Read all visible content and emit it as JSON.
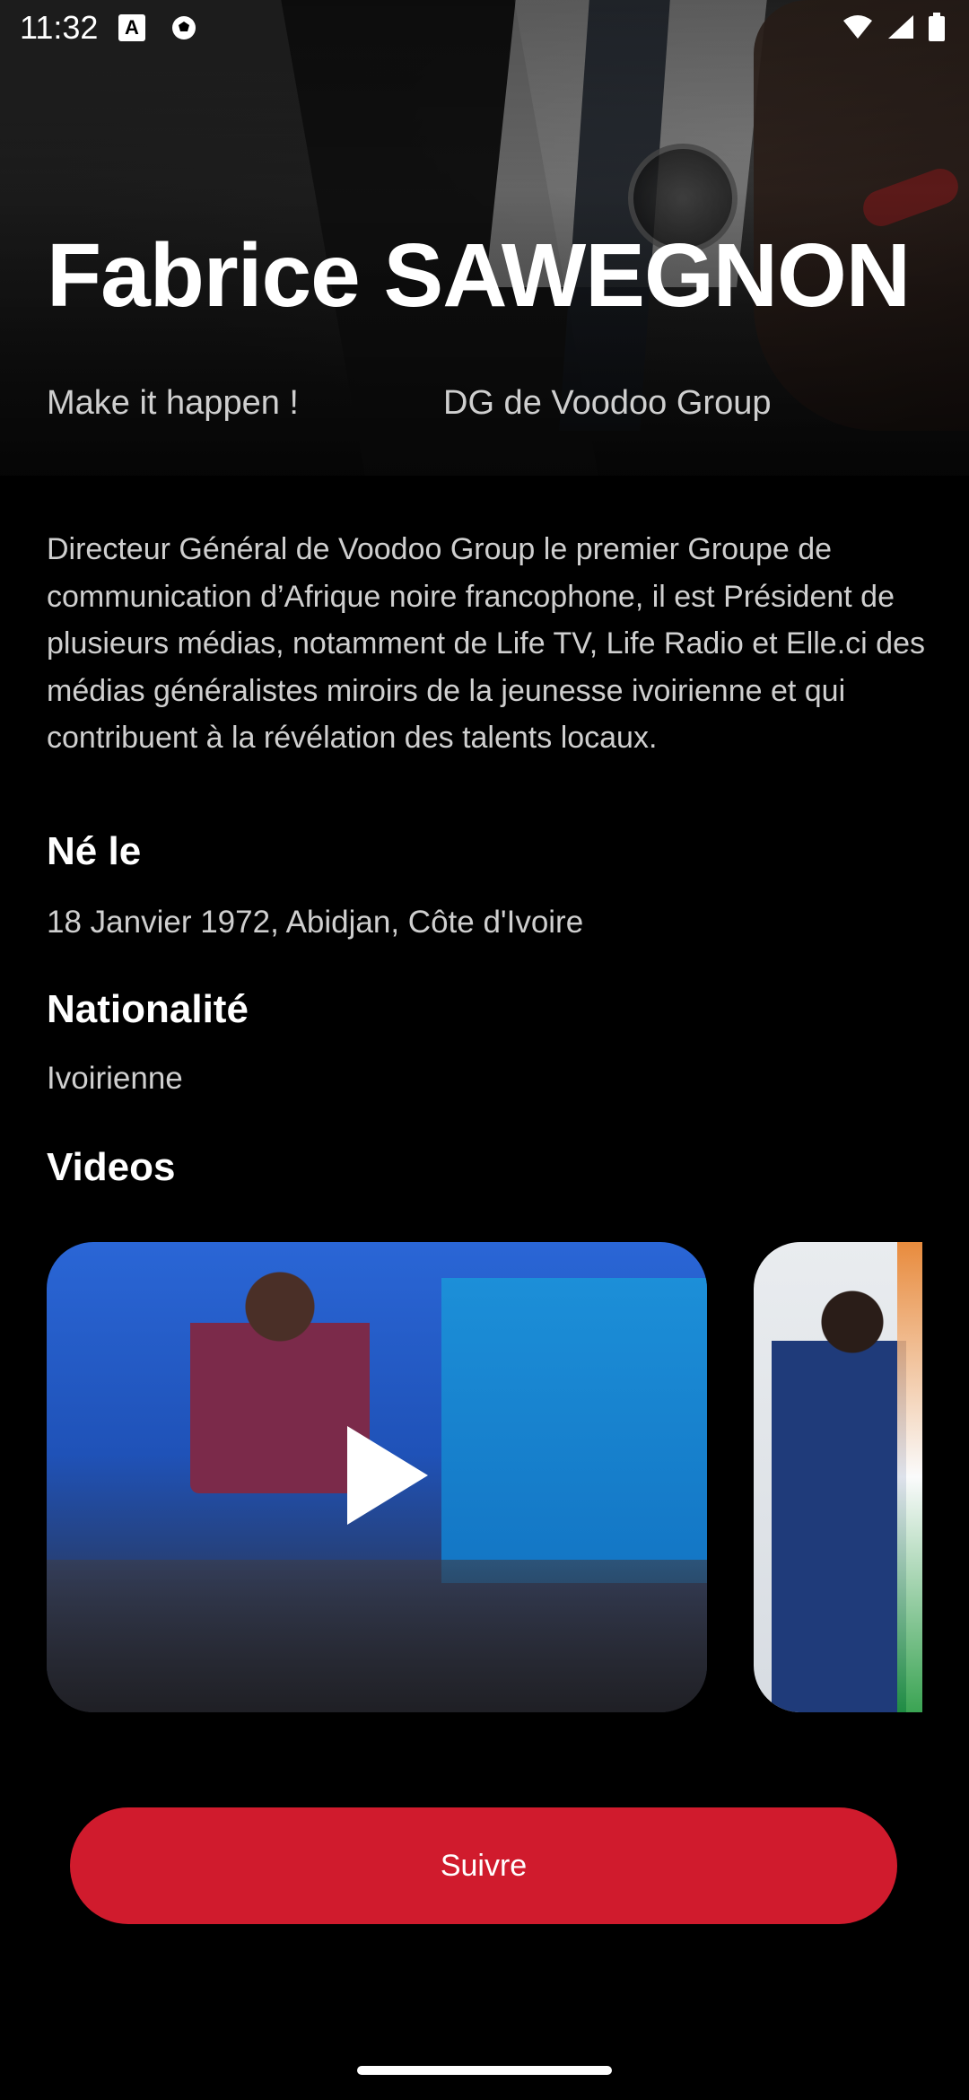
{
  "status_bar": {
    "time": "11:32",
    "left_icons": [
      "a-notification-icon",
      "soccer-ball-icon"
    ],
    "right_icons": [
      "wifi-icon",
      "signal-icon",
      "battery-icon"
    ]
  },
  "profile": {
    "name": "Fabrice SAWEGNON",
    "tagline": "Make it happen !",
    "role": "DG de Voodoo Group",
    "bio": "Directeur Général de Voodoo Group le premier Groupe de communication d’Afrique noire francophone, il est Président de plusieurs médias, notamment de  Life TV, Life Radio et Elle.ci des médias généralistes miroirs de la jeunesse ivoirienne et qui contribuent à la révélation des talents locaux."
  },
  "birth": {
    "title": "Né le",
    "value": "18 Janvier 1972, Abidjan, Côte d'Ivoire"
  },
  "nationality": {
    "title": "Nationalité",
    "value": "Ivoirienne"
  },
  "videos": {
    "title": "Videos",
    "items": [
      {
        "thumbnail": "conference-panel-thumbnail",
        "has_play_icon": true
      },
      {
        "thumbnail": "raised-hands-thumbnail",
        "has_play_icon": false
      }
    ]
  },
  "actions": {
    "follow_label": "Suivre"
  },
  "colors": {
    "background": "#000000",
    "accent": "#d01b2d",
    "text_primary": "#ffffff",
    "text_secondary": "#cfcfcf"
  }
}
